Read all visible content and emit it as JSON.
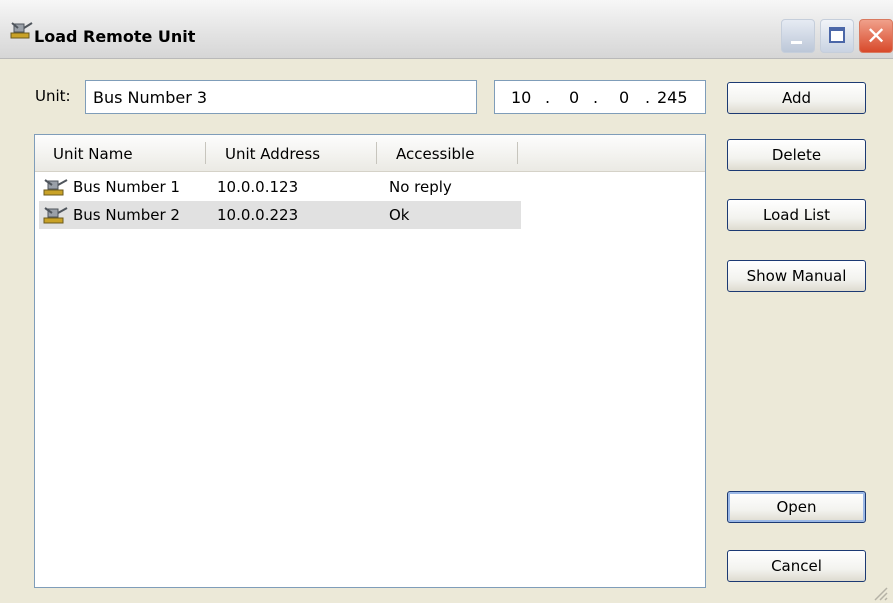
{
  "window": {
    "title": "Load Remote Unit"
  },
  "titlebar": {
    "close_glyph": "✕",
    "icons": [
      "minimize-icon",
      "maximize-icon",
      "close-icon"
    ]
  },
  "unit": {
    "label": "Unit:",
    "value": "Bus Number 3"
  },
  "ip": {
    "octets": [
      "10",
      "0",
      "0",
      "245"
    ],
    "separator": "."
  },
  "list": {
    "columns": [
      "Unit Name",
      "Unit Address",
      "Accessible"
    ],
    "rows": [
      {
        "name": "Bus Number 1",
        "address": "10.0.0.123",
        "accessible": "No reply",
        "selected": false
      },
      {
        "name": "Bus Number 2",
        "address": "10.0.0.223",
        "accessible": "Ok",
        "selected": true
      }
    ]
  },
  "buttons": {
    "add": "Add",
    "delete": "Delete",
    "load_list": "Load List",
    "show_manual": "Show Manual",
    "open": "Open",
    "cancel": "Cancel"
  },
  "colors": {
    "window_bg": "#ece9d8",
    "border_blue": "#7f9db9",
    "selected_row": "#e1e1e1",
    "close_red": "#d8492a"
  }
}
